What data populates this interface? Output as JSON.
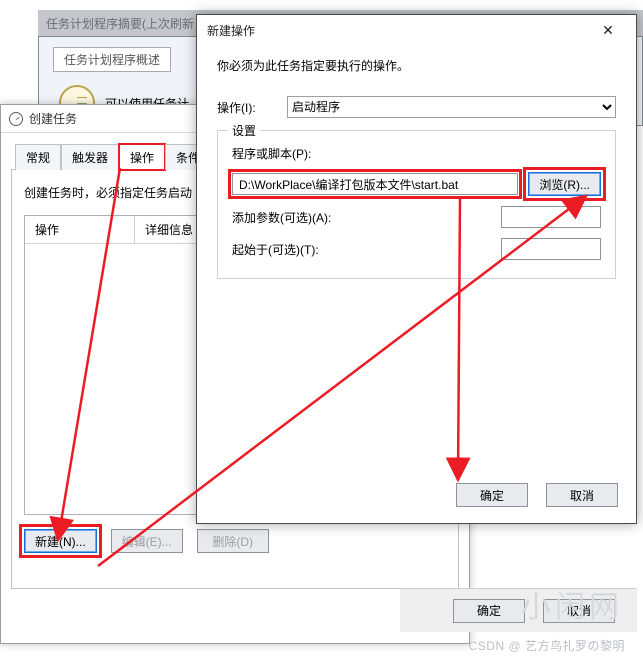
{
  "mmc": {
    "header": "任务计划程序摘要(上次刷新",
    "group_title": "任务计划程序概述",
    "hint": "可以使用任务计"
  },
  "createTask": {
    "title": "创建任务",
    "tabs": [
      "常规",
      "触发器",
      "操作",
      "条件"
    ],
    "activeTabIndex": 2,
    "pageHint": "创建任务时，必须指定任务启动",
    "list": {
      "col1": "操作",
      "col2": "详细信息"
    },
    "buttons": {
      "new": "新建(N)...",
      "edit": "编辑(E)...",
      "delete": "删除(D)"
    },
    "footer": {
      "ok": "确定",
      "cancel": "取消"
    }
  },
  "newAction": {
    "title": "新建操作",
    "hint": "你必须为此任务指定要执行的操作。",
    "actionLabel": "操作(I):",
    "actionValue": "启动程序",
    "settingsLegend": "设置",
    "fields": {
      "programLabel": "程序或脚本(P):",
      "programValue": "D:\\WorkPlace\\编译打包版本文件\\start.bat",
      "browse": "浏览(R)...",
      "argsLabel": "添加参数(可选)(A):",
      "argsValue": "",
      "startInLabel": "起始于(可选)(T):",
      "startInValue": ""
    },
    "footer": {
      "ok": "确定",
      "cancel": "取消"
    }
  },
  "watermark": {
    "big": "小闲网",
    "line": "CSDN @ 艺方鸟扎罗の黎明"
  }
}
